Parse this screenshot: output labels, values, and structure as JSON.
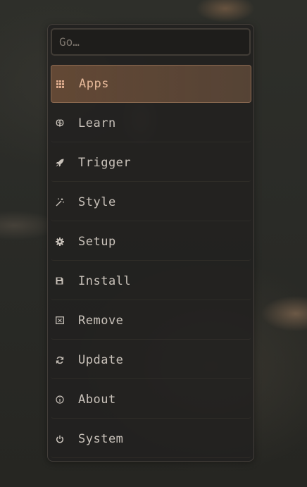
{
  "search": {
    "placeholder": "Go…",
    "value": ""
  },
  "menu": {
    "items": [
      {
        "label": "Apps",
        "icon": "grid-icon",
        "active": true
      },
      {
        "label": "Learn",
        "icon": "brain-icon"
      },
      {
        "label": "Trigger",
        "icon": "rocket-icon"
      },
      {
        "label": "Style",
        "icon": "magic-wand-icon"
      },
      {
        "label": "Setup",
        "icon": "gear-icon"
      },
      {
        "label": "Install",
        "icon": "floppy-disk-icon"
      },
      {
        "label": "Remove",
        "icon": "remove-box-icon"
      },
      {
        "label": "Update",
        "icon": "refresh-icon"
      },
      {
        "label": "About",
        "icon": "info-icon"
      },
      {
        "label": "System",
        "icon": "power-icon"
      }
    ]
  },
  "colors": {
    "accent": "#e6b99a",
    "text": "#c9c2ba",
    "active_bg": "#78553c"
  }
}
